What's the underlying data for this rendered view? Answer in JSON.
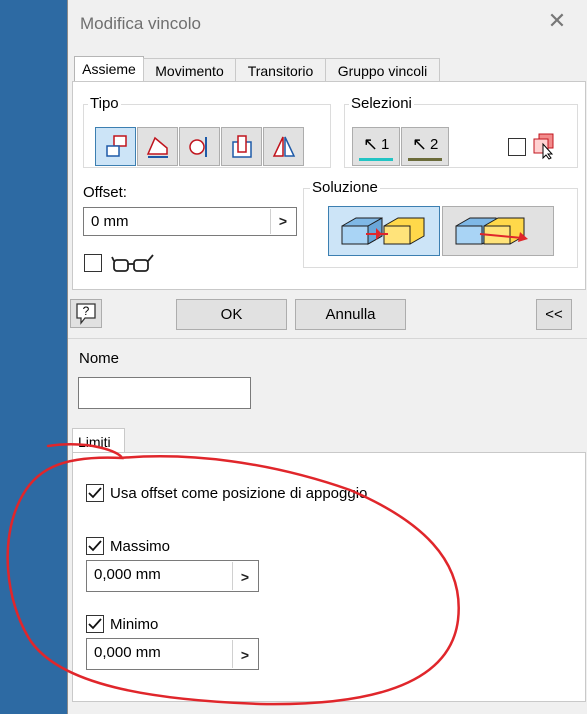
{
  "dialog": {
    "title": "Modifica vincolo"
  },
  "tabs": [
    {
      "label": "Assieme",
      "active": true
    },
    {
      "label": "Movimento",
      "active": false
    },
    {
      "label": "Transitorio",
      "active": false
    },
    {
      "label": "Gruppo vincoli",
      "active": false
    }
  ],
  "tipo": {
    "label": "Tipo",
    "buttons": [
      {
        "icon": "mate-icon",
        "selected": true
      },
      {
        "icon": "angle-icon",
        "selected": false
      },
      {
        "icon": "tangent-icon",
        "selected": false
      },
      {
        "icon": "insert-icon",
        "selected": false
      },
      {
        "icon": "symmetry-icon",
        "selected": false
      }
    ]
  },
  "selezioni": {
    "label": "Selezioni",
    "first_label": "1",
    "second_label": "2",
    "first_color": "#22c4c4",
    "second_color": "#6b6b3a"
  },
  "offset": {
    "label": "Offset:",
    "value": "0 mm",
    "arrow": ">"
  },
  "soluzione": {
    "label": "Soluzione"
  },
  "buttons": {
    "ok": "OK",
    "cancel": "Annulla",
    "expand": "<<"
  },
  "nome": {
    "label": "Nome",
    "value": ""
  },
  "limiti": {
    "tab_label": "Limiti",
    "use_offset_label": "Usa offset come posizione di appoggio",
    "use_offset_checked": true,
    "max_label": "Massimo",
    "max_checked": true,
    "max_value": "0,000 mm",
    "min_label": "Minimo",
    "min_checked": true,
    "min_value": "0,000 mm",
    "arrow": ">"
  },
  "colors": {
    "accent": "#cce4f7",
    "annotation": "#e0262b",
    "highlight": "#ffd84a"
  }
}
